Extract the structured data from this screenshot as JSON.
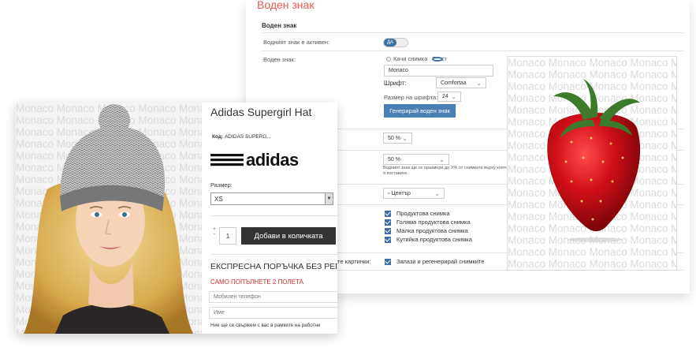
{
  "admin": {
    "title": "Воден знак",
    "section_header": "Воден знак",
    "active_label": "Водният знак е активен:",
    "toggle_text": "ДА",
    "watermark_label": "Воден знак:",
    "radio_image": "Качи снимка",
    "radio_text": "Текст",
    "text_value": "Monaco",
    "font_label": "Шрифт:",
    "font_value": "Comfortaa",
    "font_size_label": "Размер на шрифта:",
    "font_size_value": "24",
    "generate_button": "Генерирай воден знак",
    "opacity_value": "50 %",
    "size_value": "50 %",
    "size_note": "Водният знак ще се оразмери до X% от снимката върху която я поставите.",
    "position_value": "Център",
    "apply_items": [
      "Продуктова снимка",
      "Голяма продуктова снимка",
      "Малка продуктова снимка",
      "Кутийка продуктова снимка"
    ],
    "regen_label": "те картинки:",
    "regen_text": "Запази и регенерирай снимките"
  },
  "preview": {
    "watermark_word": "Monaco"
  },
  "product": {
    "title": "Adidas Supergirl Hat",
    "code_label": "Код:",
    "code_value": "ADIDAS SUPERG...",
    "brand": "adidas",
    "size_label": "Размер:",
    "size_value": "XS",
    "quantity": "1",
    "stepper_plus": "+",
    "stepper_minus": "-",
    "add_button": "Добави в количката",
    "express_title": "ЕКСПРЕСНА ПОРЪЧКА БЕЗ РЕГИ",
    "express_subtitle": "САМО ПОПЪЛНЕТЕ 2 ПОЛЕТА",
    "phone_placeholder": "Мобилен телефон",
    "name_placeholder": "Име",
    "note": "Ние ще се свържем с вас в рамките на работни"
  },
  "colors": {
    "accent_title": "#e35a4f",
    "blue_button": "#4a7fb5",
    "express_red": "#d42a2a"
  }
}
